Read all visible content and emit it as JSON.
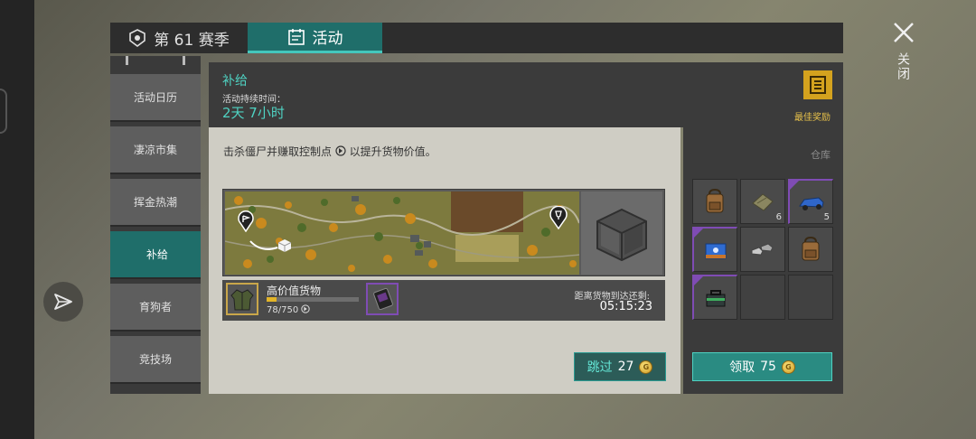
{
  "header": {
    "season_tab": "第 61 赛季",
    "activity_tab": "活动",
    "close_label": "关闭"
  },
  "sidebar": {
    "items": [
      {
        "label": "活动日历"
      },
      {
        "label": "凄凉市集"
      },
      {
        "label": "挥金热潮"
      },
      {
        "label": "补给"
      },
      {
        "label": "育狗者"
      },
      {
        "label": "竞技场"
      }
    ],
    "active_index": 3
  },
  "event": {
    "title": "补给",
    "duration_label": "活动持续时间：",
    "duration_value": "2天 7小时",
    "best_reward_label": "最佳奖励",
    "description": "击杀僵尸并赚取控制点",
    "description_suffix": "以提升货物价值。"
  },
  "cargo": {
    "label": "高价值货物",
    "current": "78",
    "total": "750",
    "count_text": "78/750",
    "progress_fraction": 0.104,
    "remaining_label": "距离货物到达还剩:",
    "remaining_time": "05:15:23"
  },
  "skip_button": {
    "label": "跳过",
    "cost": "27"
  },
  "warehouse": {
    "label": "仓库",
    "slots": [
      {
        "icon": "backpack-icon",
        "count": "",
        "rare": false
      },
      {
        "icon": "cloth-bundle-icon",
        "count": "6",
        "rare": false
      },
      {
        "icon": "blue-vehicle-icon",
        "count": "5",
        "rare": true
      },
      {
        "icon": "blue-case-icon",
        "count": "",
        "rare": true
      },
      {
        "icon": "sneakers-icon",
        "count": "",
        "rare": false
      },
      {
        "icon": "backpack-icon",
        "count": "",
        "rare": false
      },
      {
        "icon": "toolbox-icon",
        "count": "",
        "rare": true
      },
      {
        "icon": "",
        "count": "",
        "rare": false
      },
      {
        "icon": "",
        "count": "",
        "rare": false
      }
    ]
  },
  "claim_button": {
    "label": "领取",
    "cost": "75"
  },
  "colors": {
    "accent_teal": "#1f6e6a",
    "highlight_teal": "#4fd2c2",
    "gold": "#d4a21e",
    "rare_purple": "#7f4cb4"
  }
}
